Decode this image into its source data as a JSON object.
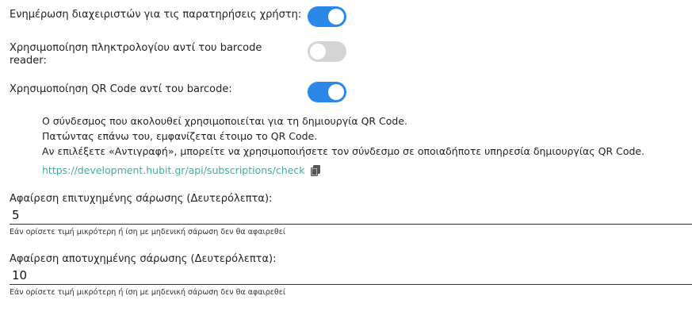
{
  "settings": {
    "notify_admins": {
      "label": "Ενημέρωση διαχειριστών για τις παρατηρήσεις χρήστη:",
      "enabled": true
    },
    "keyboard_instead_of_reader": {
      "label_line1": "Χρησιμοποίηση πληκτρολογίου αντί του barcode",
      "label_line2": "reader:",
      "enabled": false
    },
    "qr_instead_of_barcode": {
      "label": "Χρησιμοποίηση QR Code αντί του barcode:",
      "enabled": true
    }
  },
  "qr_info": {
    "line1": "Ο σύνδεσμος που ακολουθεί χρησιμοποιείται για τη δημιουργία QR Code.",
    "line2": "Πατώντας επάνω του, εμφανίζεται έτοιμο το QR Code.",
    "line3": "Αν επιλέξετε «Αντιγραφή», μπορείτε να χρησιμοποιήσετε τον σύνδεσμο σε οποιαδήποτε υπηρεσία δημιουργίας QR Code.",
    "link": "https://development.hubit.gr/api/subscriptions/check",
    "copy_icon": "copy-icon"
  },
  "fields": {
    "success_scan": {
      "label": "Αφαίρεση επιτυχημένης σάρωσης (Δευτερόλεπτα):",
      "value": "5",
      "hint": "Εάν ορίσετε τιμή μικρότερη ή ίση με μηδενική σάρωση δεν θα αφαιρεθεί"
    },
    "failed_scan": {
      "label": "Αφαίρεση αποτυχημένης σάρωσης (Δευτερόλεπτα):",
      "value": "10",
      "hint": "Εάν ορίσετε τιμή μικρότερη ή ίση με μηδενική σάρωση δεν θα αφαιρεθεί"
    }
  },
  "colors": {
    "toggle_on": "#2b87e8",
    "toggle_off": "#d4d4d4",
    "link": "#4aa89d"
  }
}
